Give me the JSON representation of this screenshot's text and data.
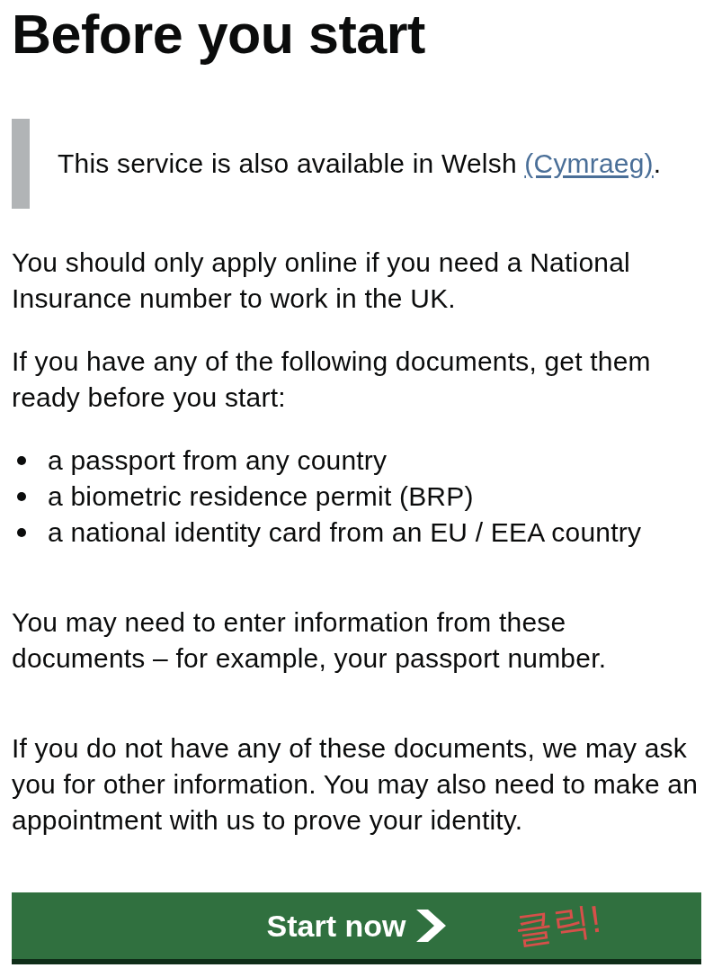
{
  "heading": {
    "text": "Before you start"
  },
  "inset": {
    "text": "This service is also available in Welsh",
    "link": "(Cymraeg)",
    "trailing": "."
  },
  "intro": [
    "You should only apply online if you need a National Insurance number to work in the UK.",
    "If you have any of the following documents, get them ready before you start:"
  ],
  "documents": [
    "a passport from any country",
    "a biometric residence permit (BRP)",
    "a national identity card from an EU / EEA country"
  ],
  "notes": [
    "You may need to enter information from these documents – for example, your passport number.",
    "If you do not have any of these documents, we may ask you for other information. You may also need to make an appointment with us to prove your identity."
  ],
  "start_button": {
    "label": "Start now"
  },
  "annotation": {
    "text": "클릭!"
  }
}
